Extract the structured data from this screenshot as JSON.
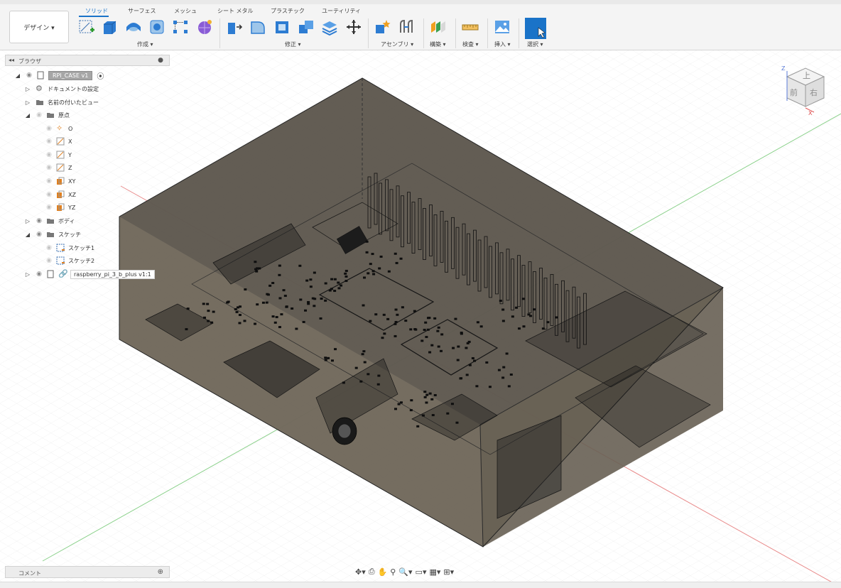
{
  "design_button": "デザイン ▾",
  "tabs": [
    "ソリッド",
    "サーフェス",
    "メッシュ",
    "シート メタル",
    "プラスチック",
    "ユーティリティ"
  ],
  "groups": {
    "create": "作成 ▾",
    "modify": "修正 ▾",
    "assembly": "アセンブリ ▾",
    "construct": "構築 ▾",
    "inspect": "検査 ▾",
    "insert": "挿入 ▾",
    "select": "選択 ▾"
  },
  "browser": {
    "title": "ブラウザ",
    "root": "RPI_CASE v1",
    "items": {
      "doc_settings": "ドキュメントの設定",
      "named_views": "名前の付いたビュー",
      "origin": "原点",
      "origin_o": "O",
      "origin_x": "X",
      "origin_y": "Y",
      "origin_z": "Z",
      "origin_xy": "XY",
      "origin_xz": "XZ",
      "origin_yz": "YZ",
      "bodies": "ボディ",
      "sketches": "スケッチ",
      "sketch1": "スケッチ1",
      "sketch2": "スケッチ2",
      "component": "raspberry_pi_3_b_plus v1:1"
    }
  },
  "comment_panel": "コメント",
  "viewcube": {
    "top": "上",
    "front": "前",
    "right": "右",
    "axis_z": "Z",
    "axis_x": "X"
  },
  "colors": {
    "accent": "#1a73c8",
    "body_fill": "#5f584c",
    "grid_line": "#d6d6d6",
    "axis_red": "#e06a6a",
    "axis_green": "#6cc46c"
  }
}
